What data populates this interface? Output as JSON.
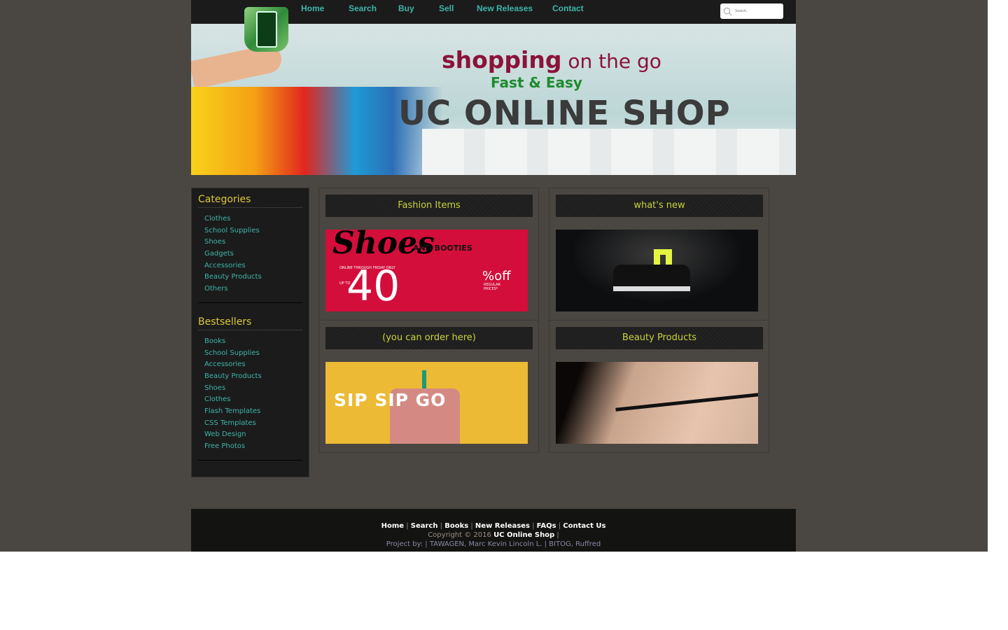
{
  "nav": {
    "items": [
      "Home",
      "Search",
      "Buy",
      "Sell",
      "New Releases",
      "Contact"
    ],
    "search_placeholder": "Search.."
  },
  "banner": {
    "line1": "shopping",
    "line1b": " on the go",
    "line2": "Fast & Easy",
    "line3": "UC ONLINE SHOP"
  },
  "sidebar": {
    "categories_title": "Categories",
    "categories": [
      "Clothes",
      "School Supplies",
      "Shoes",
      "Gadgets",
      "Accessories",
      "Beauty Products",
      "Others"
    ],
    "bestsellers_title": "Bestsellers",
    "bestsellers": [
      "Books",
      "School Supplies",
      "Accessories",
      "Beauty Products",
      "Shoes",
      "Clothes",
      "Flash Templates",
      "CSS Templates",
      "Web Design",
      "Free Photos"
    ]
  },
  "panels": [
    {
      "title": "Fashion Items",
      "img": {
        "script": "Shoes",
        "sub": "AND BOOTIES",
        "note": "ONLINE THROUGH FRIDAY ONLY",
        "upto": "UP TO",
        "num": "40",
        "off": "%off",
        "reg": "REGULAR PRICES*"
      }
    },
    {
      "title": "what's new"
    },
    {
      "title": "(you can order here)",
      "img": {
        "text": "SIP SIP GO"
      }
    },
    {
      "title": "Beauty Products"
    }
  ],
  "footer": {
    "links": [
      "Home",
      "Search",
      "Books",
      "New Releases",
      "FAQs",
      "Contact Us"
    ],
    "copyright": "Copyright © 2016",
    "shop": "UC Online Shop",
    "sep": "|",
    "project": "Project by: | TAWAGEN, Marc Kevin Lincoln L. | BITOG, Ruffred"
  },
  "colors": {
    "accent": "#3fb4a8",
    "heading": "#d9c83a",
    "bg": "#4a4641"
  }
}
